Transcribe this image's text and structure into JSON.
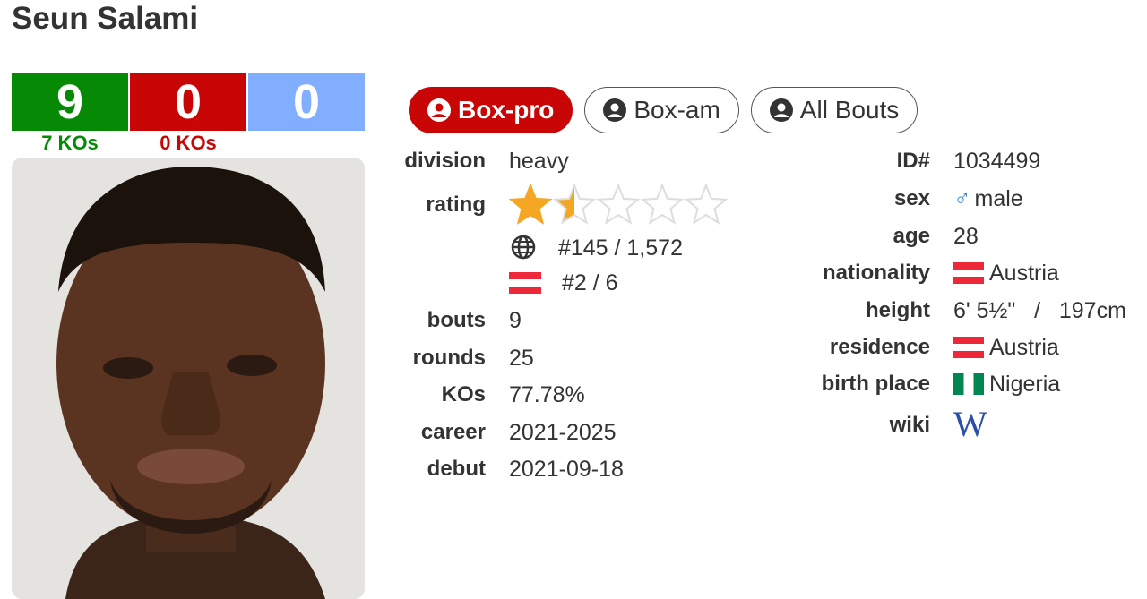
{
  "fighter_name": "Seun Salami",
  "record": {
    "wins": "9",
    "losses": "0",
    "draws": "0",
    "win_kos": "7 KOs",
    "loss_kos": "0 KOs"
  },
  "tabs": [
    {
      "label": "Box-pro",
      "active": true
    },
    {
      "label": "Box-am",
      "active": false
    },
    {
      "label": "All Bouts",
      "active": false
    }
  ],
  "left": {
    "division_label": "division",
    "division": "heavy",
    "rating_label": "rating",
    "rating_stars": 1.5,
    "rating_max": 5,
    "world_rank": "#145 / 1,572",
    "country_rank": "#2 / 6",
    "bouts_label": "bouts",
    "bouts": "9",
    "rounds_label": "rounds",
    "rounds": "25",
    "kos_label": "KOs",
    "kos": "77.78%",
    "career_label": "career",
    "career": "2021-2025",
    "debut_label": "debut",
    "debut": "2021-09-18"
  },
  "right": {
    "id_label": "ID#",
    "id": "1034499",
    "sex_label": "sex",
    "sex": "male",
    "age_label": "age",
    "age": "28",
    "nationality_label": "nationality",
    "nationality": "Austria",
    "height_label": "height",
    "height": "6' 5½\"   /   197cm",
    "residence_label": "residence",
    "residence": "Austria",
    "birthplace_label": "birth place",
    "birthplace": "Nigeria",
    "wiki_label": "wiki",
    "wiki_icon": "W"
  },
  "colors": {
    "win": "#068a06",
    "loss": "#c80606",
    "draw": "#82aeff",
    "star": "#f5a623"
  }
}
